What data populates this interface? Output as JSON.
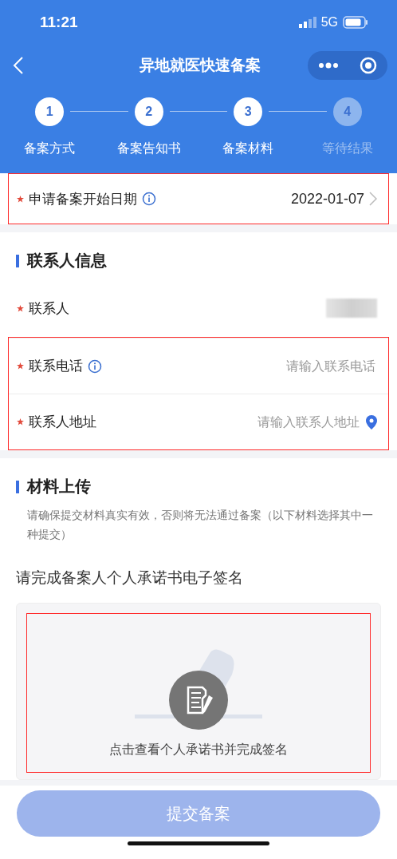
{
  "status_bar": {
    "time": "11:21",
    "network": "5G"
  },
  "nav": {
    "title": "异地就医快速备案"
  },
  "steps": [
    {
      "number": "1",
      "label": "备案方式",
      "done": true
    },
    {
      "number": "2",
      "label": "备案告知书",
      "done": true
    },
    {
      "number": "3",
      "label": "备案材料",
      "done": true
    },
    {
      "number": "4",
      "label": "等待结果",
      "done": false
    }
  ],
  "date_row": {
    "label": "申请备案开始日期",
    "required": true,
    "info": true,
    "value": "2022-01-07",
    "highlighted": true
  },
  "contact_section": {
    "title": "联系人信息",
    "fields": [
      {
        "kind": "hidden",
        "label": "联系人",
        "required": true,
        "info": false,
        "highlighted": false
      },
      {
        "kind": "input",
        "label": "联系电话",
        "required": true,
        "info": true,
        "placeholder": "请输入联系电话",
        "highlighted": true
      },
      {
        "kind": "location",
        "label": "联系人地址",
        "required": true,
        "info": false,
        "placeholder": "请输入联系人地址",
        "highlighted": true
      }
    ]
  },
  "upload_section": {
    "title": "材料上传",
    "note": "请确保提交材料真实有效，否则将无法通过备案（以下材料选择其中一种提交）",
    "subtitle": "请完成备案人个人承诺书电子签名",
    "card_caption": "点击查看个人承诺书并完成签名",
    "highlighted": true
  },
  "submit_button": {
    "label": "提交备案",
    "disabled": true
  }
}
